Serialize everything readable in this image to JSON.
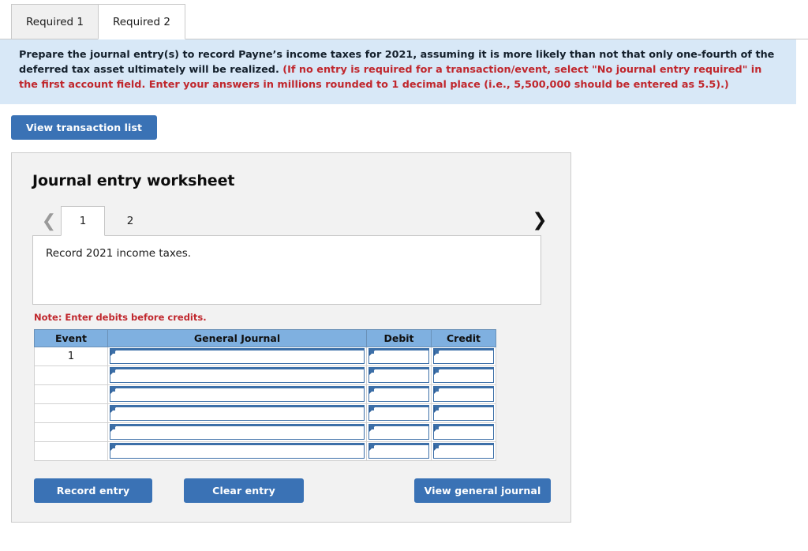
{
  "requirement_tabs": [
    {
      "label": "Required 1",
      "active": false
    },
    {
      "label": "Required 2",
      "active": true
    }
  ],
  "instruction": {
    "black_text": "Prepare the journal entry(s) to record Payne’s income taxes for 2021, assuming it is more likely than not that only one-fourth of the deferred tax asset ultimately will be realized. ",
    "red_text": "(If no entry is required for a transaction/event, select \"No journal entry required\" in the first account field. Enter your answers in millions rounded to 1 decimal place (i.e., 5,500,000 should be entered as 5.5).)"
  },
  "toolbar": {
    "view_transaction_list_label": "View transaction list"
  },
  "worksheet": {
    "title": "Journal entry worksheet",
    "pager": {
      "prev_icon": "chevron-left-icon",
      "next_icon": "chevron-right-icon",
      "tabs": [
        {
          "label": "1",
          "active": true
        },
        {
          "label": "2",
          "active": false
        }
      ]
    },
    "description": "Record 2021 income taxes.",
    "note": "Note: Enter debits before credits.",
    "table": {
      "columns": [
        "Event",
        "General Journal",
        "Debit",
        "Credit"
      ],
      "rows": [
        {
          "event": "1",
          "general_journal": "",
          "debit": "",
          "credit": ""
        },
        {
          "event": "",
          "general_journal": "",
          "debit": "",
          "credit": ""
        },
        {
          "event": "",
          "general_journal": "",
          "debit": "",
          "credit": ""
        },
        {
          "event": "",
          "general_journal": "",
          "debit": "",
          "credit": ""
        },
        {
          "event": "",
          "general_journal": "",
          "debit": "",
          "credit": ""
        },
        {
          "event": "",
          "general_journal": "",
          "debit": "",
          "credit": ""
        }
      ]
    },
    "actions": {
      "record_entry_label": "Record entry",
      "clear_entry_label": "Clear entry",
      "view_general_journal_label": "View general journal"
    }
  },
  "colors": {
    "button_blue": "#3a72b5",
    "table_header_blue": "#7fb0e0",
    "callout_bg": "#d8e8f7",
    "alert_red": "#c0272d",
    "input_border_blue": "#3c6fa8",
    "panel_bg": "#f2f2f2"
  }
}
